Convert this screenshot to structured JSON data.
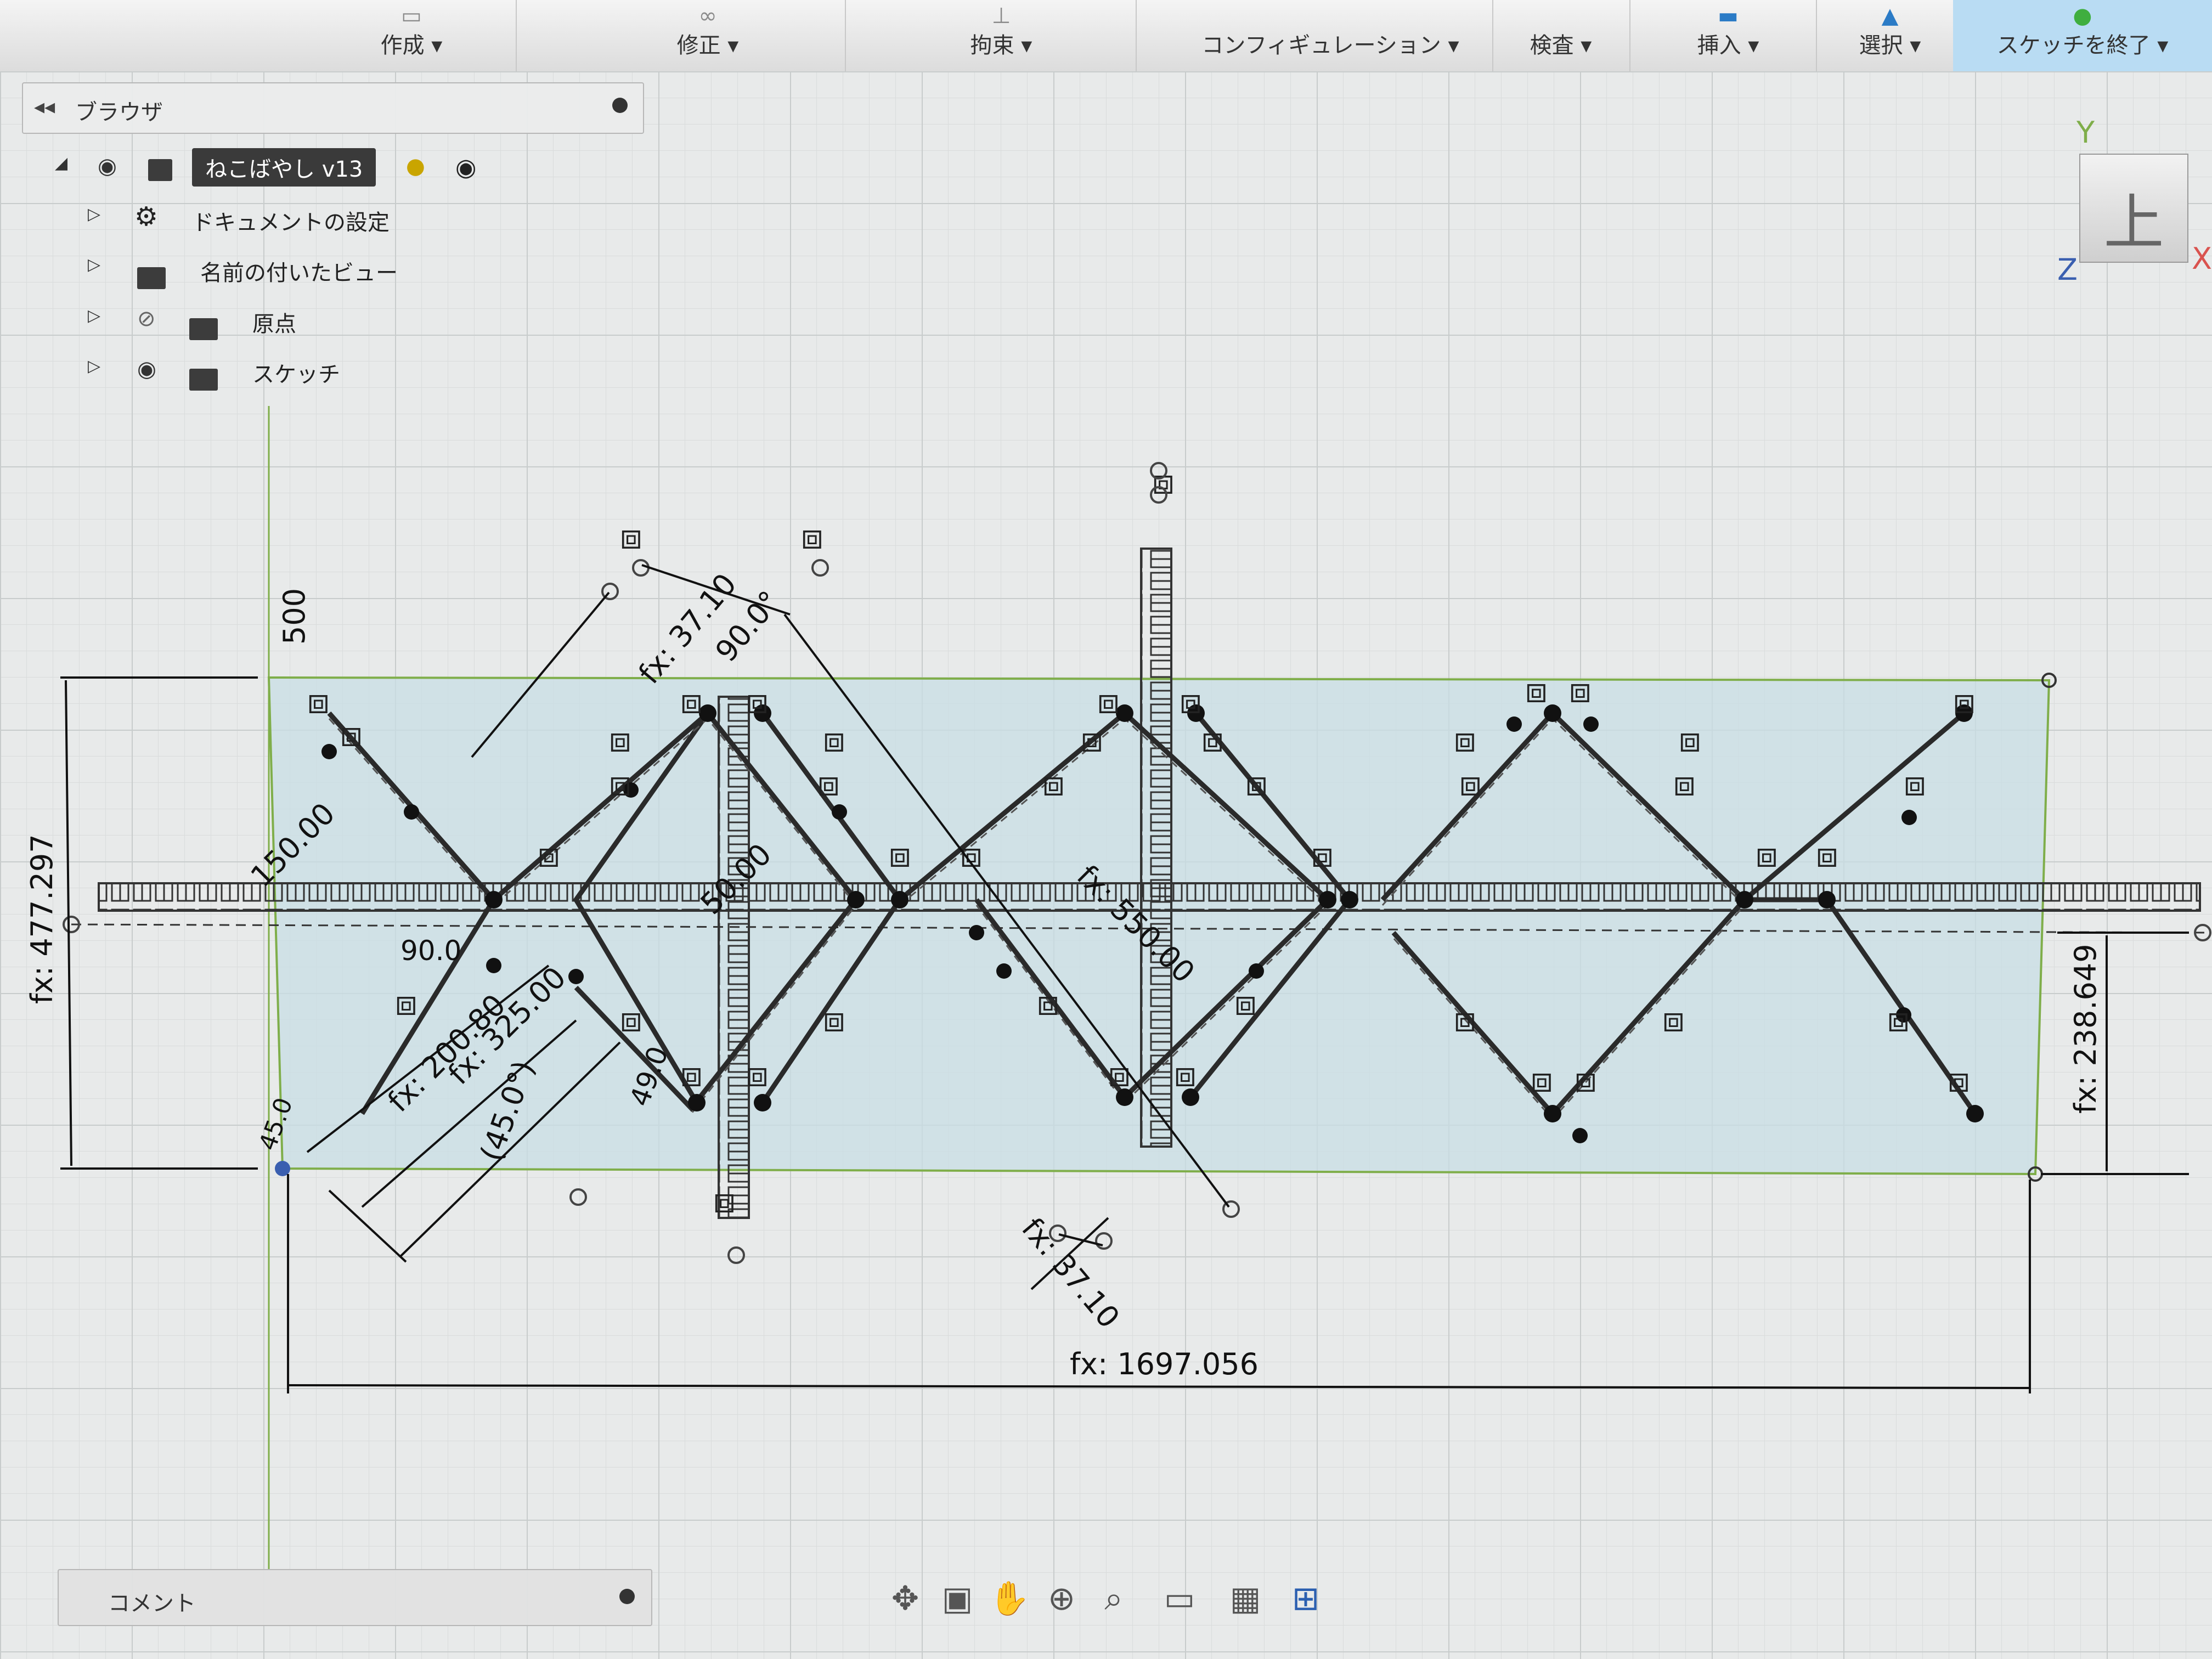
{
  "toolbar": {
    "menus": [
      {
        "label": "作成 ▾"
      },
      {
        "label": "修正 ▾"
      },
      {
        "label": "拘束 ▾"
      },
      {
        "label": "コンフィギュレーション ▾"
      },
      {
        "label": "検査 ▾"
      },
      {
        "label": "挿入 ▾"
      },
      {
        "label": "選択 ▾"
      },
      {
        "label": "スケッチを終了 ▾"
      }
    ]
  },
  "browser": {
    "title": "ブラウザ",
    "root": "ねこばやし v13",
    "items": [
      {
        "label": "ドキュメントの設定"
      },
      {
        "label": "名前の付いたビュー"
      },
      {
        "label": "原点"
      },
      {
        "label": "スケッチ"
      }
    ]
  },
  "viewcube": {
    "face": "上",
    "axis_y": "Y",
    "axis_x": "X",
    "axis_z": "Z"
  },
  "dimensions": {
    "total_width": "fx: 1697.056",
    "height_left": "fx: 477.297",
    "height_right": "fx: 238.649",
    "vertical_500": "500",
    "diag_37_top": "fx: 37.10",
    "diag_37_bottom": "fx: 37.10",
    "angle_90_top": "90.0°",
    "angle_90_left": "90.0",
    "angle_45": "(45.0°)",
    "angle_45_small": "45.0",
    "len_150": "150.00",
    "len_200": "fx: 200.80",
    "len_325": "fx: 325.00",
    "len_550": "fx: 550.00",
    "len_50": "50.00",
    "angle_49": "49.0"
  },
  "comment": {
    "label": "コメント"
  },
  "colors": {
    "sketch_region": "#c8dde4",
    "sketch_line": "#2a2a2a",
    "dimension": "#111111",
    "grid": "#c8cccc",
    "axis_green": "#7fae4a",
    "axis_red": "#d9534f",
    "axis_blue": "#3a5fb0"
  },
  "icons": [
    "gear-icon",
    "eye-icon",
    "eye-hidden-icon",
    "folder-icon",
    "orbit-icon",
    "pan-icon",
    "zoom-icon",
    "display-icon",
    "grid-icon",
    "viewports-icon"
  ]
}
